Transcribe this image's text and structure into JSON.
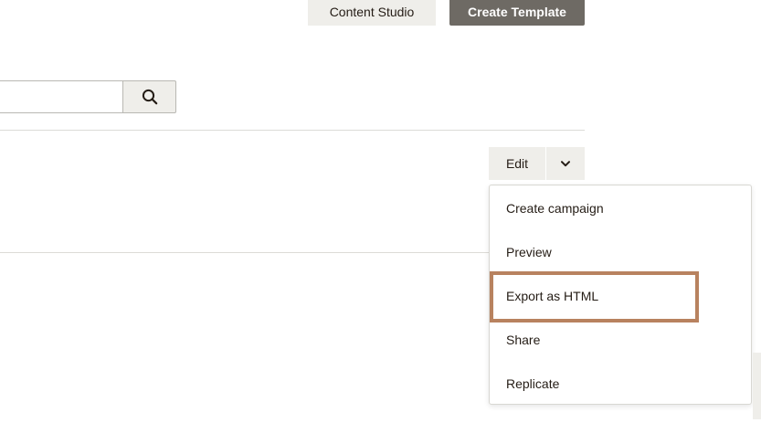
{
  "header": {
    "content_studio_label": "Content Studio",
    "create_template_label": "Create Template"
  },
  "search": {
    "value": "",
    "placeholder": ""
  },
  "template_row": {
    "edit_label": "Edit"
  },
  "dropdown_menu": {
    "items": [
      {
        "label": "Create campaign"
      },
      {
        "label": "Preview"
      },
      {
        "label": "Export as HTML",
        "highlighted": true
      },
      {
        "label": "Share"
      },
      {
        "label": "Replicate"
      }
    ]
  },
  "icons": {
    "search": "search-icon",
    "caret": "chevron-down-icon"
  },
  "colors": {
    "primary_button": "#6e6a64",
    "secondary_button": "#efeeea",
    "text": "#241c15",
    "highlight_outline": "#b8825f",
    "divider": "#dcdbd7"
  }
}
